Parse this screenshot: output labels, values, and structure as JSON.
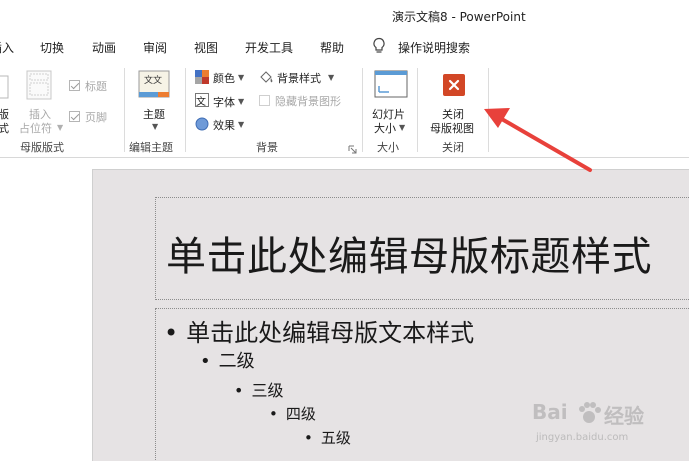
{
  "window": {
    "title": "演示文稿8  -  PowerPoint"
  },
  "tabs": [
    {
      "label": "插入"
    },
    {
      "label": "切换"
    },
    {
      "label": "动画"
    },
    {
      "label": "审阅"
    },
    {
      "label": "视图"
    },
    {
      "label": "开发工具"
    },
    {
      "label": "帮助"
    }
  ],
  "tell_me": {
    "label": "操作说明搜索",
    "icon": "lightbulb-icon"
  },
  "ribbon": {
    "master_layout": {
      "group_label": "母版版式",
      "layout_button": {
        "line1": "版",
        "line2": "式"
      },
      "insert_placeholder": {
        "line1": "插入",
        "line2": "占位符"
      },
      "title_checkbox": {
        "label": "标题",
        "checked": true
      },
      "footer_checkbox": {
        "label": "页脚",
        "checked": true
      }
    },
    "edit_theme": {
      "group_label": "编辑主题",
      "themes_button": {
        "label": "主题",
        "icon_text": "文文"
      }
    },
    "background": {
      "group_label": "背景",
      "colors": {
        "label": "颜色"
      },
      "fonts": {
        "label": "字体",
        "icon_text": "文"
      },
      "effects": {
        "label": "效果"
      },
      "background_styles": {
        "label": "背景样式"
      },
      "hide_background": {
        "label": "隐藏背景图形"
      }
    },
    "size": {
      "group_label": "大小",
      "slide_size": {
        "line1": "幻灯片",
        "line2": "大小"
      }
    },
    "close": {
      "group_label": "关闭",
      "close_master": {
        "line1": "关闭",
        "line2": "母版视图"
      },
      "accent_color": "#d24726"
    }
  },
  "slide": {
    "title_placeholder": "单击此处编辑母版标题样式",
    "body_levels": [
      {
        "text": "单击此处编辑母版文本样式"
      },
      {
        "text": "二级"
      },
      {
        "text": "三级"
      },
      {
        "text": "四级"
      },
      {
        "text": "五级"
      }
    ],
    "bullet_char": "•"
  },
  "watermark": {
    "brand": "Bai",
    "brand_cn": "经验",
    "url": "jingyan.baidu.com"
  },
  "annotation": {
    "arrow_color": "#e8413b"
  }
}
